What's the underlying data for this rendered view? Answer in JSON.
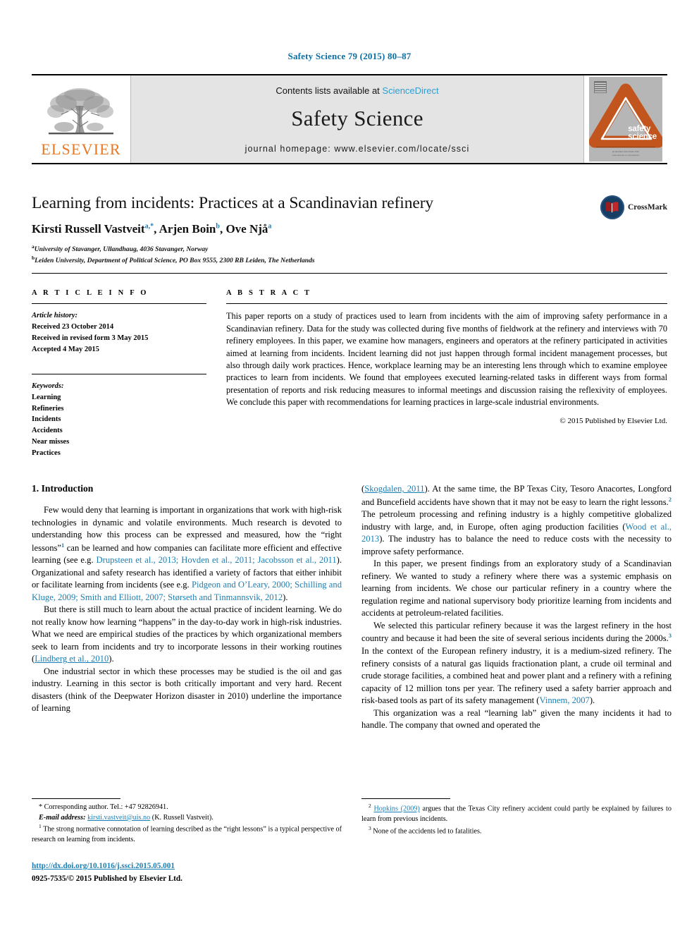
{
  "running_head": "Safety Science 79 (2015) 80–87",
  "masthead": {
    "publisher_name": "ELSEVIER",
    "publisher_logo_icon": "elsevier-tree-icon",
    "contents_prefix": "Contents lists available at ",
    "sciencedirect": "ScienceDirect",
    "journal_title": "Safety Science",
    "homepage": "journal homepage: www.elsevier.com/locate/ssci",
    "cover": {
      "line1": "safety",
      "line2": "science",
      "fineprint1": "ELSEVIER   ISSN 0925-7535",
      "fineprint2": "www.elsevier.com/locate/ssci"
    }
  },
  "article": {
    "title": "Learning from incidents: Practices at a Scandinavian refinery",
    "authors": [
      {
        "name": "Kirsti Russell Vastveit",
        "marks": "a,*"
      },
      {
        "name": "Arjen Boin",
        "marks": "b"
      },
      {
        "name": "Ove Njå",
        "marks": "a"
      }
    ],
    "affiliations": [
      {
        "mark": "a",
        "text": "University of Stavanger, Ullandhaug, 4036 Stavanger, Norway"
      },
      {
        "mark": "b",
        "text": "Leiden University, Department of Political Science, PO Box 9555, 2300 RB Leiden, The Netherlands"
      }
    ],
    "crossmark_label": "CrossMark",
    "crossmark_icon": "crossmark-book-icon"
  },
  "article_info": {
    "heading": "A R T I C L E   I N F O",
    "history_label": "Article history:",
    "history": [
      "Received 23 October 2014",
      "Received in revised form 3 May 2015",
      "Accepted 4 May 2015"
    ],
    "keywords_label": "Keywords:",
    "keywords": [
      "Learning",
      "Refineries",
      "Incidents",
      "Accidents",
      "Near misses",
      "Practices"
    ]
  },
  "abstract": {
    "heading": "A B S T R A C T",
    "text": "This paper reports on a study of practices used to learn from incidents with the aim of improving safety performance in a Scandinavian refinery. Data for the study was collected during five months of fieldwork at the refinery and interviews with 70 refinery employees. In this paper, we examine how managers, engineers and operators at the refinery participated in activities aimed at learning from incidents. Incident learning did not just happen through formal incident management processes, but also through daily work practices. Hence, workplace learning may be an interesting lens through which to examine employee practices to learn from incidents. We found that employees executed learning-related tasks in different ways from formal presentation of reports and risk reducing measures to informal meetings and discussion raising the reflexivity of employees. We conclude this paper with recommendations for learning practices in large-scale industrial environments.",
    "copyright": "© 2015 Published by Elsevier Ltd."
  },
  "section": {
    "heading": "1. Introduction"
  },
  "body": {
    "left": [
      {
        "id": "p1",
        "parts": [
          {
            "t": "Few would deny that learning is important in organizations that work with high-risk technologies in dynamic and volatile environments. Much research is devoted to understanding how this process can be expressed and measured, how the “right lessons”",
            "k": "text"
          },
          {
            "t": "1",
            "k": "fnref"
          },
          {
            "t": " can be learned and how companies can facilitate more efficient and effective learning (see e.g. ",
            "k": "text"
          },
          {
            "t": "Drupsteen et al., 2013; Hovden et al., 2011; Jacobsson et al., 2011",
            "k": "cite"
          },
          {
            "t": "). Organizational and safety research has identified a variety of factors that either inhibit or facilitate learning from incidents (see e.g. ",
            "k": "text"
          },
          {
            "t": "Pidgeon and O’Leary, 2000; Schilling and Kluge, 2009; Smith and Elliott, 2007; Størseth and Tinmannsvik, 2012",
            "k": "cite"
          },
          {
            "t": ").",
            "k": "text"
          }
        ]
      },
      {
        "id": "p2",
        "parts": [
          {
            "t": "But there is still much to learn about the actual practice of incident learning. We do not really know how learning “happens” in the day-to-day work in high-risk industries. What we need are empirical studies of the practices by which organizational members seek to learn from incidents and try to incorporate lessons in their working routines (",
            "k": "text"
          },
          {
            "t": "Lindberg et al., 2010",
            "k": "cite-u"
          },
          {
            "t": ").",
            "k": "text"
          }
        ]
      },
      {
        "id": "p3",
        "parts": [
          {
            "t": "One industrial sector in which these processes may be studied is the oil and gas industry. Learning in this sector is both critically important and very hard. Recent disasters (think of the Deepwater Horizon disaster in 2010) underline the importance of learning",
            "k": "text"
          }
        ]
      }
    ],
    "right": [
      {
        "id": "p4",
        "indent": false,
        "parts": [
          {
            "t": "(",
            "k": "text"
          },
          {
            "t": "Skogdalen, 2011",
            "k": "cite-u"
          },
          {
            "t": "). At the same time, the BP Texas City, Tesoro Anacortes, Longford and Buncefield accidents have shown that it may not be easy to learn the right lessons.",
            "k": "text"
          },
          {
            "t": "2",
            "k": "fnref"
          },
          {
            "t": " The petroleum processing and refining industry is a highly competitive globalized industry with large, and, in Europe, often aging production facilities (",
            "k": "text"
          },
          {
            "t": "Wood et al., 2013",
            "k": "cite"
          },
          {
            "t": "). The industry has to balance the need to reduce costs with the necessity to improve safety performance.",
            "k": "text"
          }
        ]
      },
      {
        "id": "p5",
        "indent": true,
        "parts": [
          {
            "t": "In this paper, we present findings from an exploratory study of a Scandinavian refinery. We wanted to study a refinery where there was a systemic emphasis on learning from incidents. We chose our particular refinery in a country where the regulation regime and national supervisory body prioritize learning from incidents and accidents at petroleum-related facilities.",
            "k": "text"
          }
        ]
      },
      {
        "id": "p6",
        "indent": true,
        "parts": [
          {
            "t": "We selected this particular refinery because it was the largest refinery in the host country and because it had been the site of several serious incidents during the 2000s.",
            "k": "text"
          },
          {
            "t": "3",
            "k": "fnref"
          },
          {
            "t": " In the context of the European refinery industry, it is a medium-sized refinery. The refinery consists of a natural gas liquids fractionation plant, a crude oil terminal and crude storage facilities, a combined heat and power plant and a refinery with a refining capacity of 12 million tons per year. The refinery used a safety barrier approach and risk-based tools as part of its safety management (",
            "k": "text"
          },
          {
            "t": "Vinnem, 2007",
            "k": "cite"
          },
          {
            "t": ").",
            "k": "text"
          }
        ]
      },
      {
        "id": "p7",
        "indent": true,
        "parts": [
          {
            "t": "This organization was a real “learning lab” given the many incidents it had to handle. The company that owned and operated the",
            "k": "text"
          }
        ]
      }
    ]
  },
  "footnotes": {
    "left": {
      "corresponding": "* Corresponding author. Tel.: +47 92826941.",
      "email_label": "E-mail address:",
      "email": "kirsti.vastveit@uis.no",
      "email_suffix": "(K. Russell Vastveit).",
      "note1_mark": "1",
      "note1": "The strong normative connotation of learning described as the “right lessons” is a typical perspective of research on learning from incidents.",
      "doi": "http://dx.doi.org/10.1016/j.ssci.2015.05.001",
      "issn": "0925-7535/© 2015 Published by Elsevier Ltd."
    },
    "right": {
      "note2_mark": "2",
      "note2_cite": "Hopkins (2009)",
      "note2": " argues that the Texas City refinery accident could partly be explained by failures to learn from previous incidents.",
      "note3_mark": "3",
      "note3": "None of the accidents led to fatalities."
    }
  },
  "colors": {
    "link_blue": "#1a7fb5",
    "header_blue": "#0b6fa4",
    "elsevier_orange": "#e87722",
    "sciencedirect_blue": "#2f9fd0"
  }
}
